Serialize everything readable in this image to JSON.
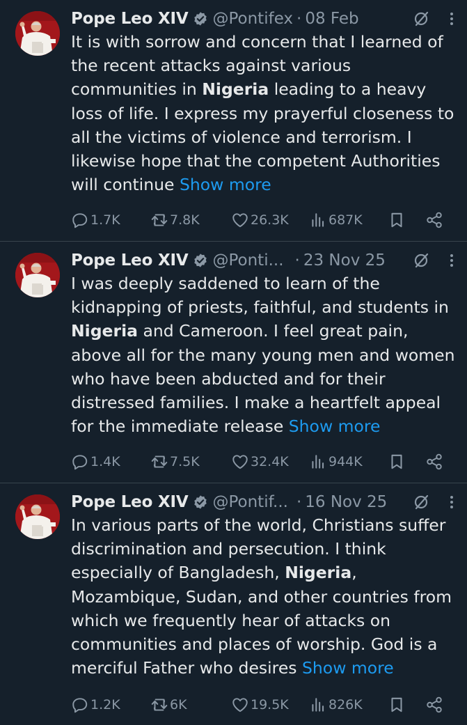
{
  "colors": {
    "background": "#15202b",
    "text": "#e7e9ea",
    "secondary_text": "#8b98a5",
    "link": "#1d9bf0",
    "verified_badge": "#8b98a5",
    "divider": "#38444d"
  },
  "icons": {
    "verified": "verified-badge-icon",
    "grok": "grok-icon",
    "more": "more-options-icon",
    "reply": "reply-icon",
    "retweet": "retweet-icon",
    "like": "heart-icon",
    "views": "views-chart-icon",
    "bookmark": "bookmark-icon",
    "share": "share-icon"
  },
  "tweets": [
    {
      "name": "Pope Leo XIV",
      "handle": "@Pontifex",
      "dot": "·",
      "date": "08 Feb",
      "text": [
        {
          "t": "It is with sorrow and concern that I learned of the recent attacks against various communities in "
        },
        {
          "b": "Nigeria"
        },
        {
          "t": " leading to a heavy loss of life.  I express my prayerful closeness to all the victims of violence and terrorism.  I likewise hope that the competent Authorities will continue "
        }
      ],
      "show_more": "Show more",
      "replies": "1.7K",
      "retweets": "7.8K",
      "likes": "26.3K",
      "views": "687K"
    },
    {
      "name": "Pope Leo XIV",
      "handle": "@Ponti...",
      "dot": "·",
      "date": "23 Nov 25",
      "text": [
        {
          "t": "I was deeply saddened to learn of the kidnapping of priests, faithful, and students in "
        },
        {
          "b": "Nigeria"
        },
        {
          "t": " and Cameroon. I feel great pain, above all for the many young men and women who have been abducted and for their distressed families. I make a heartfelt appeal for the immediate release "
        }
      ],
      "show_more": "Show more",
      "replies": "1.4K",
      "retweets": "7.5K",
      "likes": "32.4K",
      "views": "944K"
    },
    {
      "name": "Pope Leo XIV",
      "handle": "@Pontif...",
      "dot": "·",
      "date": "16 Nov 25",
      "text": [
        {
          "t": "In various parts of the world, Christians suffer discrimination and persecution. I think especially of Bangladesh, "
        },
        {
          "b": "Nigeria"
        },
        {
          "t": ", Mozambique, Sudan, and other countries from which we frequently hear of attacks on communities and places of worship. God is a merciful Father who desires "
        }
      ],
      "show_more": "Show more",
      "replies": "1.2K",
      "retweets": "6K",
      "likes": "19.5K",
      "views": "826K"
    }
  ]
}
